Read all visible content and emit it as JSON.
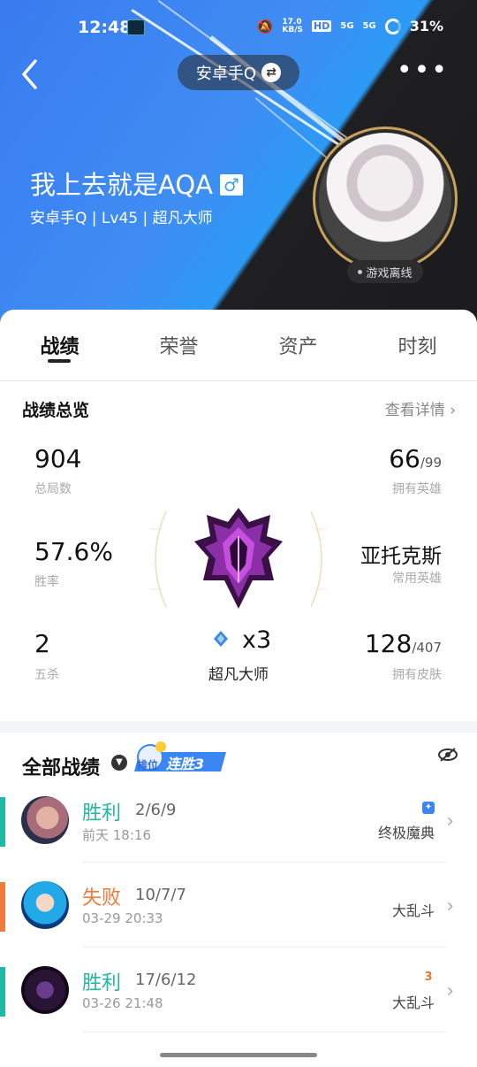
{
  "status_bar": {
    "time": "12:48",
    "net_speed": "17.0\nKB/S",
    "hd": "HD",
    "sig1": "5G",
    "sig2": "5G",
    "battery": "31%"
  },
  "header": {
    "account_switch": "安卓手Q",
    "player_name": "我上去就是AQA",
    "gender_icon": "male-icon",
    "subtitle": "安卓手Q | Lv45 | 超凡大师",
    "online_status": "游戏离线"
  },
  "tabs": [
    {
      "label": "战绩"
    },
    {
      "label": "荣誉"
    },
    {
      "label": "资产"
    },
    {
      "label": "时刻"
    }
  ],
  "overview": {
    "title": "战绩总览",
    "detail_link": "查看详情",
    "total_games": {
      "value": "904",
      "label": "总局数"
    },
    "winrate": {
      "value": "57.6%",
      "label": "胜率"
    },
    "pentakills": {
      "value": "2",
      "label": "五杀"
    },
    "owned_champs": {
      "value": "66",
      "total": "/99",
      "label": "拥有英雄"
    },
    "common_champ": {
      "value": "亚托克斯",
      "label": "常用英雄"
    },
    "owned_skins": {
      "value": "128",
      "total": "/407",
      "label": "拥有皮肤"
    },
    "rank": {
      "count": "x3",
      "name": "超凡大师"
    }
  },
  "matches": {
    "title": "全部战绩",
    "streak_badge": {
      "tag": "排位",
      "text": "连胜3"
    },
    "items": [
      {
        "result": "胜利",
        "kda": "2/6/9",
        "time": "前天 18:16",
        "mode": "终极魔典",
        "color": "#1fb8a3",
        "badge": "ultimate-spellbook-icon"
      },
      {
        "result": "失败",
        "kda": "10/7/7",
        "time": "03-29 20:33",
        "mode": "大乱斗",
        "color": "#f07a3a",
        "badge": ""
      },
      {
        "result": "胜利",
        "kda": "17/6/12",
        "time": "03-26 21:48",
        "mode": "大乱斗",
        "color": "#1fb8a3",
        "badge": "triple-kill-icon",
        "badge_text": "3"
      }
    ]
  },
  "colors": {
    "win": "#1fb8a3",
    "loss": "#f07a3a",
    "accent_blue": "#3a7bf0",
    "gold": "#c9a35c"
  }
}
